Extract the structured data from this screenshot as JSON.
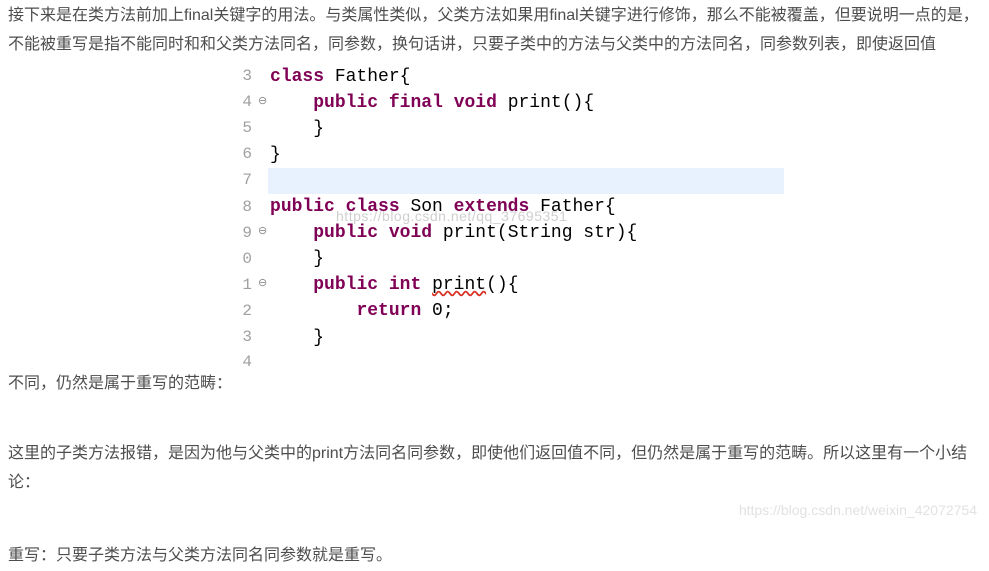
{
  "para1": "接下来是在类方法前加上final关键字的用法。与类属性类似，父类方法如果用final关键字进行修饰，那么不能被覆盖，但要说明一点的是，不能被重写是指不能同时和和父类方法同名，同参数，换句话讲，只要子类中的方法与父类中的方法同名，同参数列表，即使返回值不同，仍然是属于重写的范畴：",
  "para2": "这里的子类方法报错，是因为他与父类中的print方法同名同参数，即使他们返回值不同，但仍然是属于重写的范畴。所以这里有一个小结论：",
  "para3": "重写：只要子类方法与父类方法同名同参数就是重写。",
  "watermark1": "https://blog.csdn.net/qq_37695351",
  "watermark2": "https://blog.csdn.net/weixin_42072754",
  "code": {
    "lines": [
      {
        "n": "3",
        "m": "",
        "hl": false,
        "seg": [
          [
            "kw",
            "class"
          ],
          [
            "plain",
            " Father{"
          ]
        ]
      },
      {
        "n": "4",
        "m": "⊖",
        "hl": false,
        "seg": [
          [
            "plain",
            "    "
          ],
          [
            "kw",
            "public"
          ],
          [
            "plain",
            " "
          ],
          [
            "kw",
            "final"
          ],
          [
            "plain",
            " "
          ],
          [
            "kw",
            "void"
          ],
          [
            "plain",
            " print(){"
          ]
        ]
      },
      {
        "n": "5",
        "m": "",
        "hl": false,
        "seg": [
          [
            "plain",
            "    }"
          ]
        ]
      },
      {
        "n": "6",
        "m": "",
        "hl": false,
        "seg": [
          [
            "plain",
            "}"
          ]
        ]
      },
      {
        "n": "7",
        "m": "",
        "hl": true,
        "seg": [
          [
            "plain",
            "                                          "
          ]
        ]
      },
      {
        "n": "8",
        "m": "",
        "hl": false,
        "seg": [
          [
            "kw",
            "public"
          ],
          [
            "plain",
            " "
          ],
          [
            "kw",
            "class"
          ],
          [
            "plain",
            " Son "
          ],
          [
            "kw",
            "extends"
          ],
          [
            "plain",
            " Father{"
          ]
        ]
      },
      {
        "n": "9",
        "m": "⊖",
        "hl": false,
        "seg": [
          [
            "plain",
            "    "
          ],
          [
            "kw",
            "public"
          ],
          [
            "plain",
            " "
          ],
          [
            "kw",
            "void"
          ],
          [
            "plain",
            " print(String str){"
          ]
        ]
      },
      {
        "n": "0",
        "m": "",
        "hl": false,
        "seg": [
          [
            "plain",
            "    }"
          ]
        ]
      },
      {
        "n": "1",
        "m": "⊖",
        "hl": false,
        "seg": [
          [
            "plain",
            "    "
          ],
          [
            "kw",
            "public"
          ],
          [
            "plain",
            " "
          ],
          [
            "kw",
            "int"
          ],
          [
            "plain",
            " "
          ],
          [
            "err",
            "print"
          ],
          [
            "plain",
            "(){"
          ]
        ]
      },
      {
        "n": "2",
        "m": "",
        "hl": false,
        "seg": [
          [
            "plain",
            "        "
          ],
          [
            "kw",
            "return"
          ],
          [
            "plain",
            " 0;"
          ]
        ]
      },
      {
        "n": "3",
        "m": "",
        "hl": false,
        "seg": [
          [
            "plain",
            "    }"
          ]
        ]
      },
      {
        "n": "4",
        "m": "",
        "hl": false,
        "seg": []
      }
    ]
  }
}
